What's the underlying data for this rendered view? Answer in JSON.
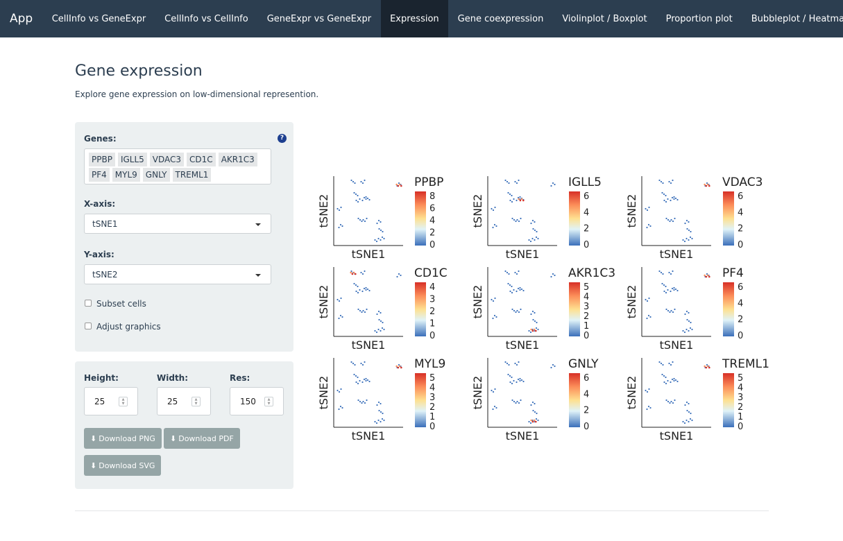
{
  "nav": {
    "brand": "App",
    "tabs": [
      "CellInfo vs GeneExpr",
      "CellInfo vs CellInfo",
      "GeneExpr vs GeneExpr",
      "Expression",
      "Gene coexpression",
      "Violinplot / Boxplot",
      "Proportion plot",
      "Bubbleplot / Heatmap"
    ],
    "active_tab": "Expression"
  },
  "page": {
    "title": "Gene expression",
    "subtitle": "Explore gene expression on low-dimensional represention."
  },
  "controls": {
    "genes_label": "Genes:",
    "help_icon": "?",
    "genes": [
      "PPBP",
      "IGLL5",
      "VDAC3",
      "CD1C",
      "AKR1C3",
      "PF4",
      "MYL9",
      "GNLY",
      "TREML1"
    ],
    "xaxis_label": "X-axis:",
    "xaxis_value": "tSNE1",
    "yaxis_label": "Y-axis:",
    "yaxis_value": "tSNE2",
    "subset_label": "Subset cells",
    "adjust_label": "Adjust graphics",
    "height_label": "Height:",
    "height_value": "25",
    "width_label": "Width:",
    "width_value": "25",
    "res_label": "Res:",
    "res_value": "150",
    "btn_png": "Download PNG",
    "btn_pdf": "Download PDF",
    "btn_svg": "Download SVG"
  },
  "colors": {
    "navbar": "#2c3e50",
    "navbar_active": "#1a242f",
    "panel": "#ecf0f1",
    "button": "#95a5a6",
    "low": "#3a6fba",
    "high": "#d73027"
  },
  "plots": {
    "xlabel": "tSNE1",
    "ylabel": "tSNE2",
    "panels": [
      {
        "gene": "PPBP",
        "ticks": [
          "8",
          "6",
          "4",
          "2",
          "0"
        ],
        "hot": "topright"
      },
      {
        "gene": "IGLL5",
        "ticks": [
          "6",
          "4",
          "2",
          "0"
        ],
        "hot": "mid"
      },
      {
        "gene": "VDAC3",
        "ticks": [
          "6",
          "4",
          "2",
          "0"
        ],
        "hot": "topright"
      },
      {
        "gene": "CD1C",
        "ticks": [
          "4",
          "3",
          "2",
          "1",
          "0"
        ],
        "hot": "topleft"
      },
      {
        "gene": "AKR1C3",
        "ticks": [
          "5",
          "4",
          "3",
          "2",
          "1",
          "0"
        ],
        "hot": "bottomright"
      },
      {
        "gene": "PF4",
        "ticks": [
          "6",
          "4",
          "2",
          "0"
        ],
        "hot": "topright"
      },
      {
        "gene": "MYL9",
        "ticks": [
          "5",
          "4",
          "3",
          "2",
          "1",
          "0"
        ],
        "hot": "topright"
      },
      {
        "gene": "GNLY",
        "ticks": [
          "6",
          "4",
          "2",
          "0"
        ],
        "hot": "bottomright"
      },
      {
        "gene": "TREML1",
        "ticks": [
          "5",
          "4",
          "3",
          "2",
          "1",
          "0"
        ],
        "hot": "topright"
      }
    ]
  }
}
